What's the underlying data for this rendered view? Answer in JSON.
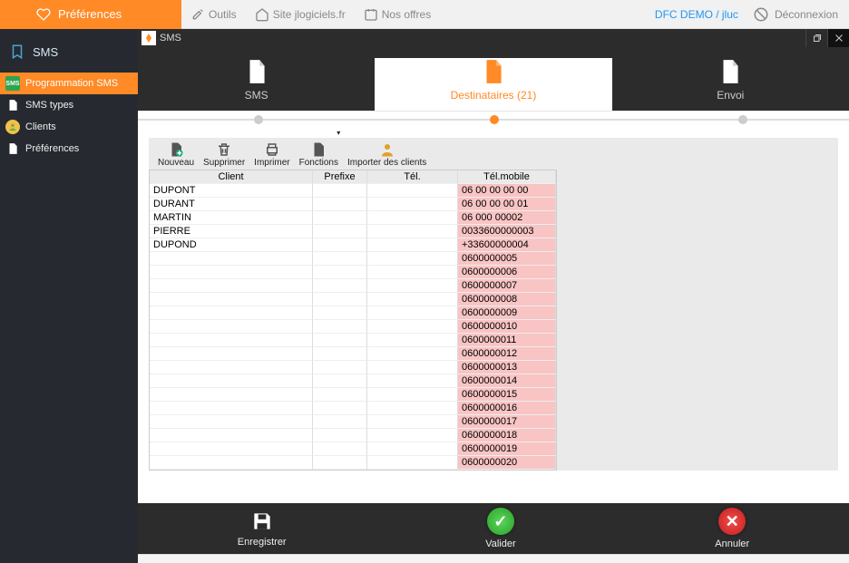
{
  "top": {
    "prefs": "Préférences",
    "tools": "Outils",
    "site": "Site jlogiciels.fr",
    "offers": "Nos offres",
    "user": "DFC DEMO / jluc",
    "logout": "Déconnexion"
  },
  "sidebar": {
    "header": "SMS",
    "items": [
      {
        "label": "Programmation SMS"
      },
      {
        "label": "SMS types"
      },
      {
        "label": "Clients"
      },
      {
        "label": "Préférences"
      }
    ]
  },
  "window": {
    "title": "SMS"
  },
  "steps": [
    {
      "label": "SMS"
    },
    {
      "label": "Destinataires (21)"
    },
    {
      "label": "Envoi"
    }
  ],
  "toolbar": {
    "new": "Nouveau",
    "delete": "Supprimer",
    "print": "Imprimer",
    "functions": "Fonctions",
    "import": "Importer des clients"
  },
  "table": {
    "headers": {
      "client": "Client",
      "prefix": "Prefixe",
      "tel": "Tél.",
      "mobile": "Tél.mobile"
    },
    "rows": [
      {
        "client": "DUPONT",
        "prefix": "",
        "tel": "",
        "mobile": "06 00 00 00 00"
      },
      {
        "client": "DURANT",
        "prefix": "",
        "tel": "",
        "mobile": "06 00 00 00 01"
      },
      {
        "client": "MARTIN",
        "prefix": "",
        "tel": "",
        "mobile": "06 000 00002"
      },
      {
        "client": "PIERRE",
        "prefix": "",
        "tel": "",
        "mobile": "0033600000003"
      },
      {
        "client": "DUPOND",
        "prefix": "",
        "tel": "",
        "mobile": "+33600000004"
      },
      {
        "client": "",
        "prefix": "",
        "tel": "",
        "mobile": "0600000005"
      },
      {
        "client": "",
        "prefix": "",
        "tel": "",
        "mobile": "0600000006"
      },
      {
        "client": "",
        "prefix": "",
        "tel": "",
        "mobile": "0600000007"
      },
      {
        "client": "",
        "prefix": "",
        "tel": "",
        "mobile": "0600000008"
      },
      {
        "client": "",
        "prefix": "",
        "tel": "",
        "mobile": "0600000009"
      },
      {
        "client": "",
        "prefix": "",
        "tel": "",
        "mobile": "0600000010"
      },
      {
        "client": "",
        "prefix": "",
        "tel": "",
        "mobile": "0600000011"
      },
      {
        "client": "",
        "prefix": "",
        "tel": "",
        "mobile": "0600000012"
      },
      {
        "client": "",
        "prefix": "",
        "tel": "",
        "mobile": "0600000013"
      },
      {
        "client": "",
        "prefix": "",
        "tel": "",
        "mobile": "0600000014"
      },
      {
        "client": "",
        "prefix": "",
        "tel": "",
        "mobile": "0600000015"
      },
      {
        "client": "",
        "prefix": "",
        "tel": "",
        "mobile": "0600000016"
      },
      {
        "client": "",
        "prefix": "",
        "tel": "",
        "mobile": "0600000017"
      },
      {
        "client": "",
        "prefix": "",
        "tel": "",
        "mobile": "0600000018"
      },
      {
        "client": "",
        "prefix": "",
        "tel": "",
        "mobile": "0600000019"
      },
      {
        "client": "",
        "prefix": "",
        "tel": "",
        "mobile": "0600000020"
      }
    ]
  },
  "actions": {
    "save": "Enregistrer",
    "validate": "Valider",
    "cancel": "Annuler"
  }
}
